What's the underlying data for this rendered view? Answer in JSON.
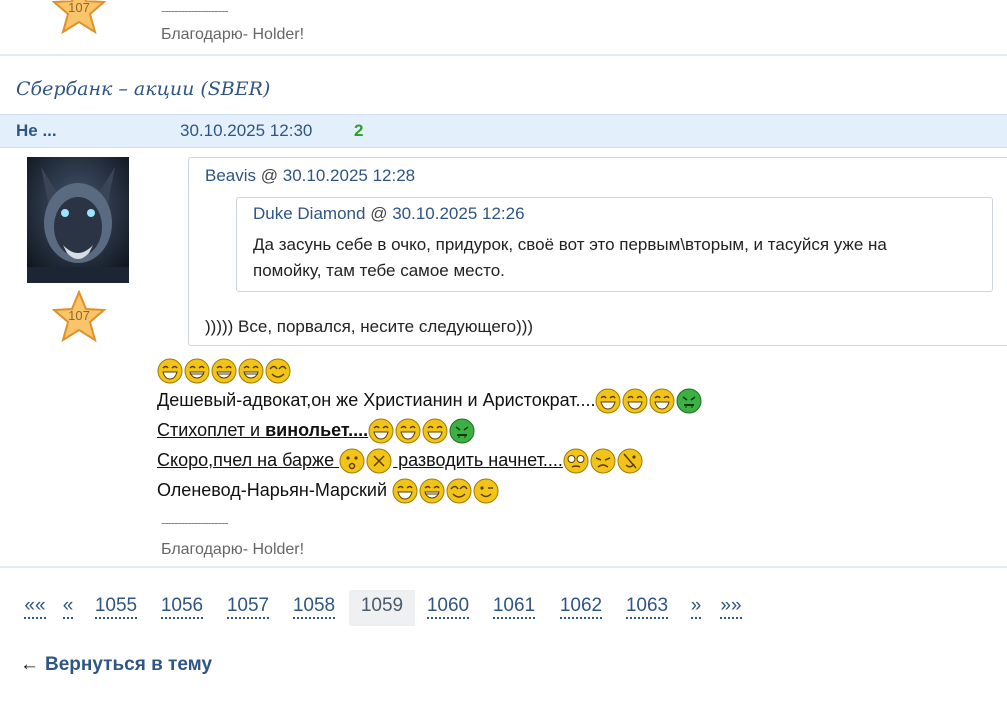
{
  "top_post": {
    "rating": "107",
    "signature_line": "--------------------",
    "signature_thanks": "Благодарю- Holder!"
  },
  "topic": {
    "title": "Сбербанк – акции (SBER)"
  },
  "post": {
    "author": "Не ...",
    "date": "30.10.2025 12:30",
    "rating_count": "2",
    "avatar_rating": "107",
    "quote": {
      "author": "Beavis",
      "at": "@",
      "date": "30.10.2025 12:28",
      "nested": {
        "author": "Duke Diamond",
        "at": "@",
        "date": "30.10.2025 12:26",
        "line1": "Да засунь себе в очко, придурок, своё вот это первым\\вторым, и тасуйся уже на",
        "line2": "помойку, там тебе самое место."
      },
      "text": "))))) Все, порвался, несите следующего)))"
    },
    "lines": {
      "l2": "Дешевый-адвокат,он же Христианин и Аристократ....",
      "l3a": "Стихоплет и ",
      "l3b": "винольет....",
      "l4a": "Скоро,пчел на барже ",
      "l4b": " разводить начнет....",
      "l5": "Оленевод-Нарьян-Марский "
    },
    "signature_line": "--------------------",
    "signature_thanks": "Благодарю- Holder!"
  },
  "pager": {
    "first": "««",
    "prev": "«",
    "pages": [
      "1055",
      "1056",
      "1057",
      "1058",
      "1059",
      "1060",
      "1061",
      "1062",
      "1063"
    ],
    "current": "1059",
    "next": "»",
    "last": "»»"
  },
  "back_link": {
    "arrow": "←",
    "label": "Вернуться в тему"
  },
  "colors": {
    "link": "#2f5585",
    "header_bg": "#e4effc",
    "rating_green": "#2ca02c",
    "smiley_yellow": "#f2c417",
    "smiley_green": "#3cb043"
  },
  "icons": [
    "star-rating-icon",
    "laughing-smiley-icon",
    "grin-smiley-icon",
    "happy-smiley-icon",
    "sick-smiley-icon",
    "confused-smiley-icon",
    "annoyed-smiley-icon",
    "nerd-smiley-icon",
    "dizzy-smiley-icon",
    "wink-smiley-icon"
  ]
}
